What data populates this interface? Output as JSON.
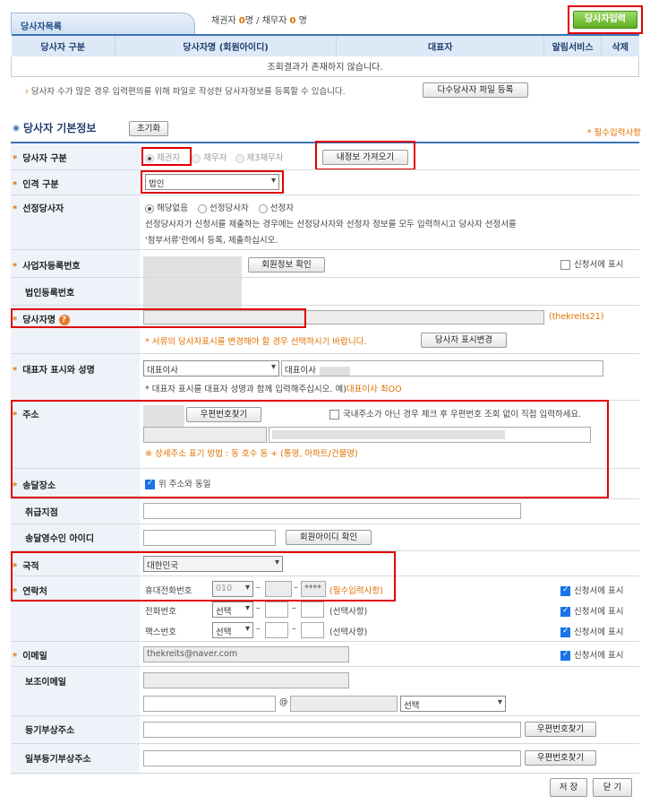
{
  "header": {
    "tab_title": "당사자목록",
    "counts_prefix": "채권자 ",
    "creditor_count": "0",
    "counts_mid": "명 / 채무자 ",
    "debtor_count": "0",
    "counts_suffix": " 명",
    "add_party_button": "당사자입력"
  },
  "list": {
    "columns": [
      "당사자 구분",
      "당사자명 (회원아이디)",
      "대표자",
      "알림서비스",
      "삭제"
    ],
    "empty_message": "조회결과가 존재하지 않습니다."
  },
  "notice": {
    "text": "당사자 수가 많은 경우 입력편의를 위해 파일로 작성한 당사자정보를 등록할 수 있습니다.",
    "bulk_button": "다수당사자 파일 등록"
  },
  "section": {
    "title": "당사자 기본정보",
    "reset_button": "초기화",
    "required_note": "* 필수입력사항"
  },
  "form": {
    "party_type": {
      "label": "당사자 구분",
      "options": [
        "채권자",
        "채무자",
        "제3채무자"
      ],
      "load_button": "내정보 가져오기"
    },
    "person_type": {
      "label": "인격 구분",
      "value": "법인"
    },
    "designated": {
      "label": "선정당사자",
      "options": [
        "해당없음",
        "선정당사자",
        "선정자"
      ],
      "desc1": "선정당사자가 신청서를 제출하는 경우에는 선정당사자와 선정자 정보를 모두 입력하시고 당사자 선정서를",
      "desc2": "'첨부서류'란에서 등록, 제출하십시오."
    },
    "biz_no": {
      "label": "사업자등록번호",
      "check_button": "회원정보 확인",
      "show_label": "신청서에 표시"
    },
    "corp_no": {
      "label": "법인등록번호"
    },
    "party_name": {
      "label": "당사자명",
      "member_id": "(thekreits21)",
      "note": "* 서류의 당사자표시를 변경해야 할 경우 선택하시기 바랍니다.",
      "change_button": "당사자 표시변경"
    },
    "representative": {
      "label": "대표자 표시와 성명",
      "select_value": "대표이사",
      "input_value": "대표이사",
      "note_prefix": "* 대표자 표시를 대표자 성명과 함께 입력해주십시오. 예)",
      "note_example": "대표이사 최OO"
    },
    "address": {
      "label": "주소",
      "zip_button": "우편번호찾기",
      "foreign_check": "국내주소가 아닌 경우 체크 후 우편번호 조회 없이 직접 입력하세요.",
      "note": "※ 상세주소 표기 방법 : 동 호수 동 + (통명, 아파트/건물명)"
    },
    "delivery": {
      "label": "송달장소",
      "same_label": "위 주소와 동일"
    },
    "branch": {
      "label": "취급지점"
    },
    "receiver_id": {
      "label": "송달영수인 아이디",
      "check_button": "회원아이디 확인"
    },
    "nationality": {
      "label": "국적",
      "value": "대한민국"
    },
    "contact": {
      "label": "연락처",
      "rows": [
        {
          "name": "휴대전화번호",
          "select": "010",
          "mid": "",
          "last": "****",
          "hint": "(필수입력사항)"
        },
        {
          "name": "전화번호",
          "select": "선택",
          "mid": "",
          "last": "",
          "hint": "(선택사항)"
        },
        {
          "name": "팩스번호",
          "select": "선택",
          "mid": "",
          "last": "",
          "hint": "(선택사항)"
        }
      ],
      "show_label": "신청서에 표시"
    },
    "email": {
      "label": "이메일",
      "value": "thekreits@naver.com",
      "show_label": "신청서에 표시"
    },
    "sub_email": {
      "label": "보조이메일",
      "at": "@",
      "domain_select": "선택"
    },
    "reg_address": {
      "label": "등기부상주소",
      "zip_button": "우편번호찾기"
    },
    "partial_reg_address": {
      "label": "일부등기부상주소",
      "zip_button": "우편번호찾기"
    }
  },
  "footer": {
    "save_button": "저 장",
    "close_button": "닫 기"
  },
  "colors": {
    "accent": "#3b73b5",
    "required": "#e07000",
    "highlight": "#e00000",
    "primary_button": "#6cc02b"
  }
}
